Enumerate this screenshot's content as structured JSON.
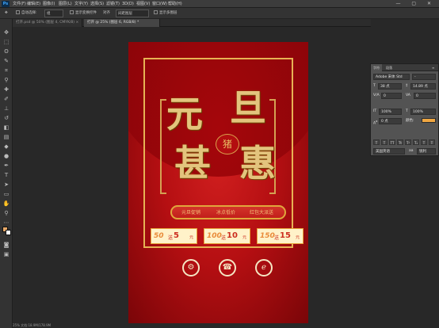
{
  "app": {
    "logo": "Ps"
  },
  "menu": [
    "文件(F)",
    "编辑(E)",
    "图像(I)",
    "图层(L)",
    "文字(Y)",
    "选择(S)",
    "滤镜(T)",
    "3D(D)",
    "视图(V)",
    "窗口(W)",
    "帮助(H)"
  ],
  "window_controls": "— ▢ ✕",
  "options": {
    "auto_select_label": "自动选择:",
    "auto_select_value": "组",
    "transform_label": "显示变换控件",
    "align_label": "对齐",
    "spacing_label": "间距图层",
    "extra_label": "显示多图层"
  },
  "tabs": [
    {
      "label": "打开.psd @ 50% (图层 4, CMYK/8) ×"
    },
    {
      "label": "打开 @ 25% (图层 6, RGB/8) *",
      "active": true
    }
  ],
  "poster": {
    "calligraphy": [
      "元",
      "旦",
      "甚",
      "惠"
    ],
    "pig_text": "猪",
    "pill_items": [
      "元旦促销",
      "冰点低价",
      "红包大派送"
    ],
    "coupons": [
      {
        "num": "50",
        "mid": "送",
        "value": "5",
        "unit": "元"
      },
      {
        "num": "100",
        "mid": "送",
        "value": "10",
        "unit": "元"
      },
      {
        "num": "150",
        "mid": "送",
        "value": "15",
        "unit": "元"
      }
    ],
    "icons": [
      "⚙",
      "☎",
      "ℯ"
    ]
  },
  "panel": {
    "tabs": [
      "字符",
      "段落"
    ],
    "font_family": "Adobe 宋体 Std",
    "font_style": "-",
    "font_size": "38 点",
    "leading": "14.89 点",
    "kerning": "0",
    "tracking": "0",
    "scale_v": "100%",
    "scale_h": "100%",
    "baseline": "0 点",
    "color_label": "颜色:",
    "format_buttons": [
      "T",
      "T",
      "TT",
      "Tt",
      "T¹",
      "T₁",
      "T",
      "Ŧ"
    ],
    "language": "美国英语",
    "aa_label": "aa",
    "aa_value": "锐利",
    "color": "#f0a742"
  },
  "status": "25%  文档:18.9M/178.9M"
}
